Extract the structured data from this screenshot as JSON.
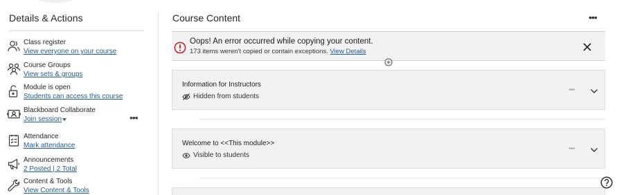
{
  "sidebar": {
    "title": "Details & Actions",
    "items": [
      {
        "icon": "users-icon",
        "label": "Class register",
        "link": "View everyone on your course"
      },
      {
        "icon": "groups-icon",
        "label": "Course Groups",
        "link": "View sets & groups"
      },
      {
        "icon": "unlock-icon",
        "label": "Module is open",
        "link": "Students can access this course"
      },
      {
        "icon": "collaborate-icon",
        "label": "Blackboard Collaborate",
        "link": "Join session"
      },
      {
        "icon": "attendance-icon",
        "label": "Attendance",
        "link": "Mark attendance"
      },
      {
        "icon": "megaphone-icon",
        "label": "Announcements",
        "link": "2 Posted | 2 Total"
      },
      {
        "icon": "wrench-icon",
        "label": "Content & Tools",
        "link": "View Content & Tools"
      }
    ],
    "more_label": "•••"
  },
  "main": {
    "title": "Course Content",
    "more_label": "•••",
    "alert": {
      "title": "Oops! An error occurred while copying your content.",
      "message": "173 items weren't copied or contain exceptions.",
      "link": "View Details",
      "color": "#c0262c"
    },
    "modules": [
      {
        "title": "Information for Instructors",
        "status": "Hidden from students",
        "status_icon": "eye-slash-icon"
      },
      {
        "title": "Welcome to <<This module>>",
        "status": "Visible to students",
        "status_icon": "eye-icon"
      }
    ],
    "card_more_label": "•••"
  },
  "colors": {
    "link": "#1f5c99",
    "error": "#c0262c",
    "card_bg": "#f2f2f2"
  }
}
